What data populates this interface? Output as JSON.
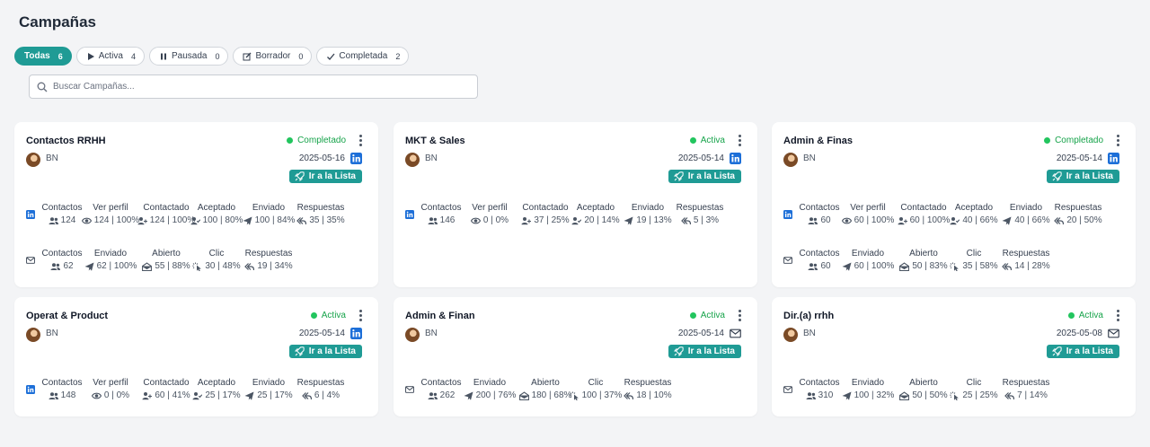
{
  "page": {
    "title": "Campañas"
  },
  "filters": [
    {
      "label": "Todas",
      "count": "6"
    },
    {
      "label": "Activa",
      "count": "4"
    },
    {
      "label": "Pausada",
      "count": "0"
    },
    {
      "label": "Borrador",
      "count": "0"
    },
    {
      "label": "Completada",
      "count": "2"
    }
  ],
  "search": {
    "placeholder": "Buscar Campañas..."
  },
  "list_button_label": "Ir a la Lista",
  "colors": {
    "accent": "#1f9b95",
    "status_green": "#22c55e",
    "linkedin": "#1d6fd8"
  },
  "cards": [
    {
      "title": "Contactos RRHH",
      "owner": "BN",
      "status": "Completado",
      "date": "2025-05-16",
      "channel_icon": "linkedin-icon",
      "linkedin_metrics": [
        {
          "label": "Contactos",
          "value": "124"
        },
        {
          "label": "Ver perfil",
          "value": "124 | 100%"
        },
        {
          "label": "Contactado",
          "value": "124 | 100%"
        },
        {
          "label": "Aceptado",
          "value": "100 | 80%"
        },
        {
          "label": "Enviado",
          "value": "100 | 84%"
        },
        {
          "label": "Respuestas",
          "value": "35 | 35%"
        }
      ],
      "email_metrics": [
        {
          "label": "Contactos",
          "value": "62"
        },
        {
          "label": "Enviado",
          "value": "62 | 100%"
        },
        {
          "label": "Abierto",
          "value": "55 | 88%"
        },
        {
          "label": "Clic",
          "value": "30 | 48%"
        },
        {
          "label": "Respuestas",
          "value": "19 | 34%"
        }
      ]
    },
    {
      "title": "MKT & Sales",
      "owner": "BN",
      "status": "Activa",
      "date": "2025-05-14",
      "channel_icon": "linkedin-icon",
      "linkedin_metrics": [
        {
          "label": "Contactos",
          "value": "146"
        },
        {
          "label": "Ver perfil",
          "value": "0 | 0%"
        },
        {
          "label": "Contactado",
          "value": "37 | 25%"
        },
        {
          "label": "Aceptado",
          "value": "20 | 14%"
        },
        {
          "label": "Enviado",
          "value": "19 | 13%"
        },
        {
          "label": "Respuestas",
          "value": "5 | 3%"
        }
      ]
    },
    {
      "title": "Admin & Finas",
      "owner": "BN",
      "status": "Completado",
      "date": "2025-05-14",
      "channel_icon": "linkedin-icon",
      "linkedin_metrics": [
        {
          "label": "Contactos",
          "value": "60"
        },
        {
          "label": "Ver perfil",
          "value": "60 | 100%"
        },
        {
          "label": "Contactado",
          "value": "60 | 100%"
        },
        {
          "label": "Aceptado",
          "value": "40 | 66%"
        },
        {
          "label": "Enviado",
          "value": "40 | 66%"
        },
        {
          "label": "Respuestas",
          "value": "20 | 50%"
        }
      ],
      "email_metrics": [
        {
          "label": "Contactos",
          "value": "60"
        },
        {
          "label": "Enviado",
          "value": "60 | 100%"
        },
        {
          "label": "Abierto",
          "value": "50 | 83%"
        },
        {
          "label": "Clic",
          "value": "35 | 58%"
        },
        {
          "label": "Respuestas",
          "value": "14 | 28%"
        }
      ]
    },
    {
      "title": "Operat & Product",
      "owner": "BN",
      "status": "Activa",
      "date": "2025-05-14",
      "channel_icon": "linkedin-icon",
      "linkedin_metrics": [
        {
          "label": "Contactos",
          "value": "148"
        },
        {
          "label": "Ver perfil",
          "value": "0 | 0%"
        },
        {
          "label": "Contactado",
          "value": "60 | 41%"
        },
        {
          "label": "Aceptado",
          "value": "25 | 17%"
        },
        {
          "label": "Enviado",
          "value": "25 | 17%"
        },
        {
          "label": "Respuestas",
          "value": "6 | 4%"
        }
      ]
    },
    {
      "title": "Admin & Finan",
      "owner": "BN",
      "status": "Activa",
      "date": "2025-05-14",
      "channel_icon": "mail-icon",
      "email_metrics": [
        {
          "label": "Contactos",
          "value": "262"
        },
        {
          "label": "Enviado",
          "value": "200 | 76%"
        },
        {
          "label": "Abierto",
          "value": "180 | 68%"
        },
        {
          "label": "Clic",
          "value": "100 | 37%"
        },
        {
          "label": "Respuestas",
          "value": "18 | 10%"
        }
      ]
    },
    {
      "title": "Dir.(a) rrhh",
      "owner": "BN",
      "status": "Activa",
      "date": "2025-05-08",
      "channel_icon": "mail-icon",
      "email_metrics": [
        {
          "label": "Contactos",
          "value": "310"
        },
        {
          "label": "Enviado",
          "value": "100 | 32%"
        },
        {
          "label": "Abierto",
          "value": "50 | 50%"
        },
        {
          "label": "Clic",
          "value": "25 | 25%"
        },
        {
          "label": "Respuestas",
          "value": "7 | 14%"
        }
      ]
    }
  ]
}
